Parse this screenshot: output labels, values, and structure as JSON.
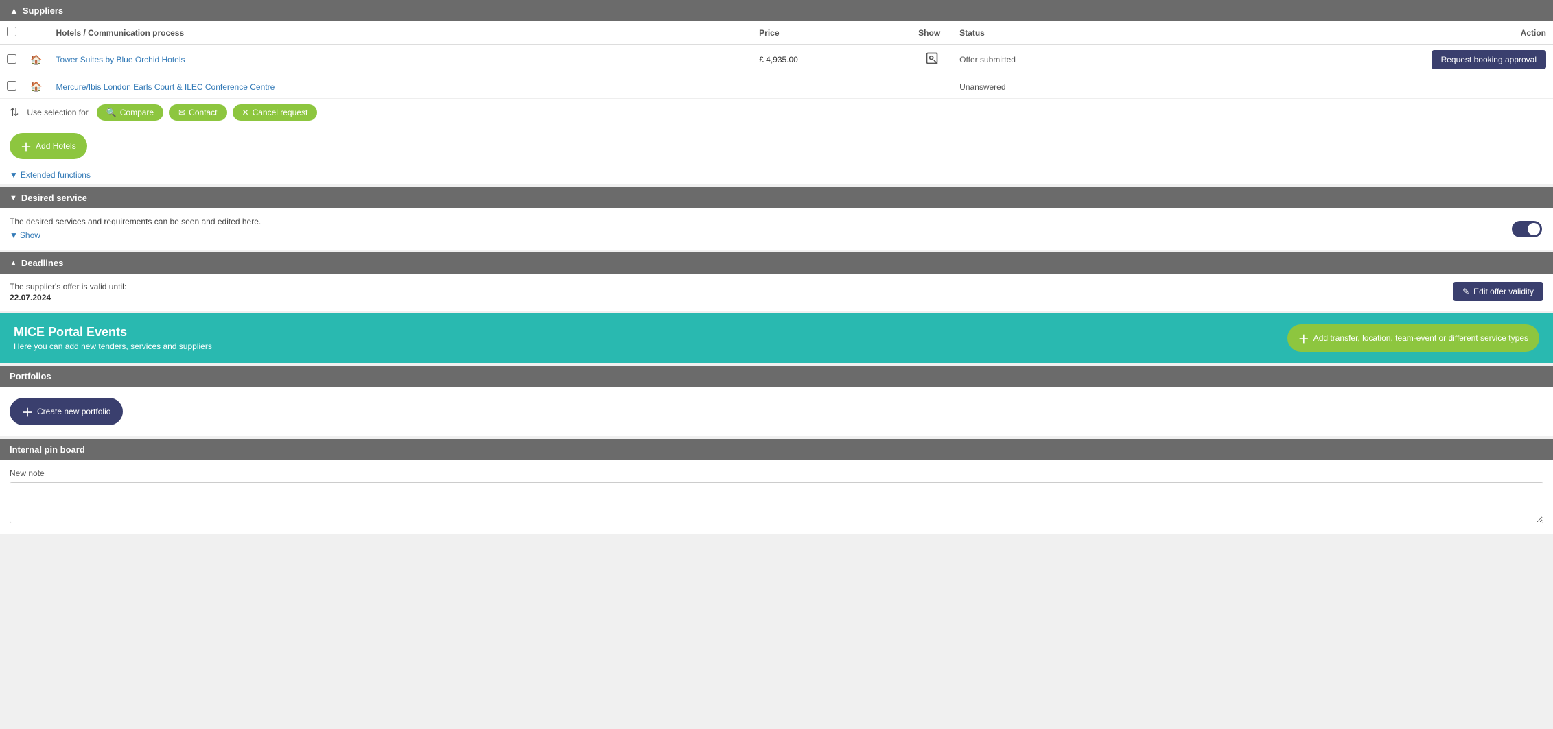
{
  "suppliers": {
    "header_label": "Suppliers",
    "columns": {
      "checkbox": "",
      "hotels": "Hotels / Communication process",
      "price": "Price",
      "show": "Show",
      "status": "Status",
      "action": "Action"
    },
    "rows": [
      {
        "hotel_name": "Tower Suites by Blue Orchid Hotels",
        "price": "£ 4,935.00",
        "status": "Offer submitted",
        "action_label": "Request booking approval"
      },
      {
        "hotel_name": "Mercure/Ibis London Earls Court & ILEC Conference Centre",
        "price": "",
        "status": "Unanswered",
        "action_label": ""
      }
    ],
    "selection_label": "Use selection for",
    "compare_label": "Compare",
    "contact_label": "Contact",
    "cancel_request_label": "Cancel request",
    "add_hotels_label": "Add Hotels",
    "extended_functions_label": "Extended functions"
  },
  "desired_service": {
    "header_label": "Desired service",
    "description": "The desired services and requirements can be seen and edited here.",
    "show_label": "Show"
  },
  "deadlines": {
    "header_label": "Deadlines",
    "offer_valid_label": "The supplier's offer is valid until:",
    "offer_date": "22.07.2024",
    "edit_validity_label": "Edit offer validity"
  },
  "mice_portal": {
    "title": "MICE Portal Events",
    "subtitle": "Here you can add new tenders, services and suppliers",
    "add_button_label": "Add transfer, location, team-event or different service types"
  },
  "portfolios": {
    "header_label": "Portfolios",
    "create_button_label": "Create new portfolio"
  },
  "internal_pin_board": {
    "header_label": "Internal pin board",
    "new_note_label": "New note",
    "textarea_placeholder": ""
  },
  "icons": {
    "chevron_up": "▲",
    "chevron_down": "▼",
    "plus": "+",
    "search": "🔍",
    "envelope": "✉",
    "times": "✕",
    "home": "🏠",
    "eye": "👁",
    "pencil": "✎"
  }
}
